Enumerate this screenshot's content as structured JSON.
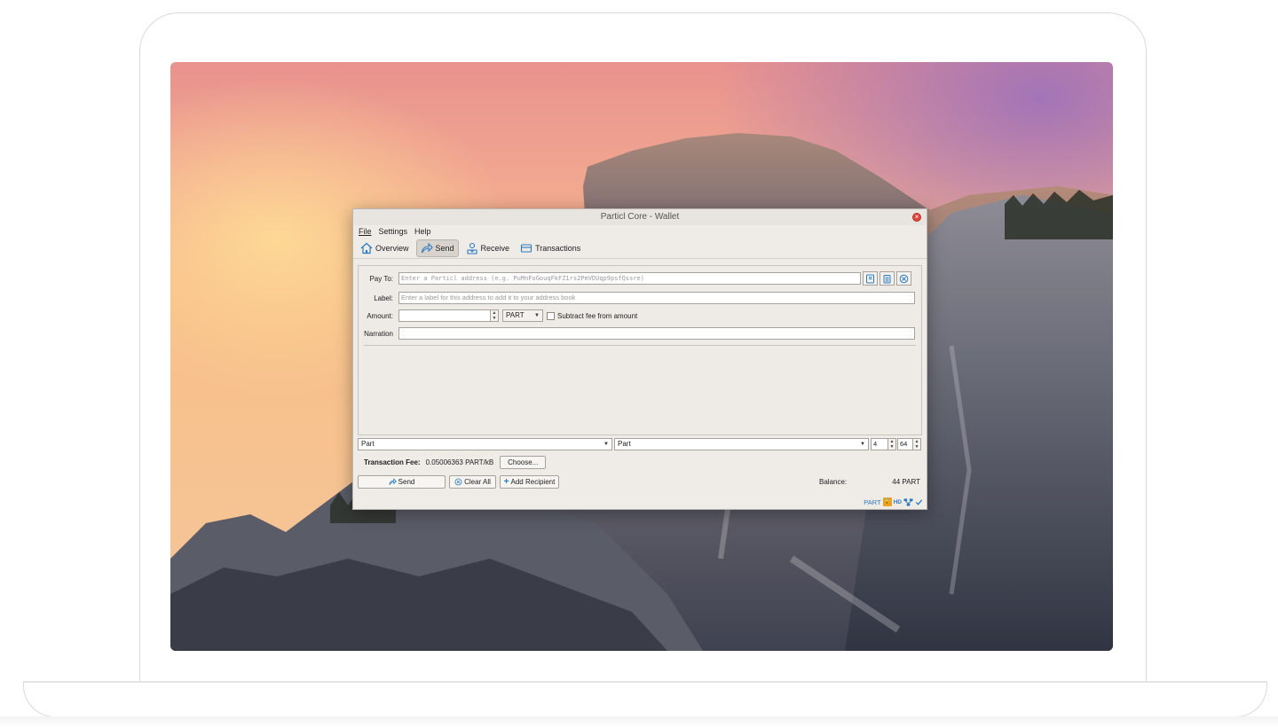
{
  "window": {
    "title": "Particl Core - Wallet",
    "close_glyph": "×"
  },
  "menu": {
    "file": "File",
    "settings": "Settings",
    "help": "Help"
  },
  "toolbar": {
    "overview": "Overview",
    "send": "Send",
    "receive": "Receive",
    "transactions": "Transactions",
    "active_tab": "Send"
  },
  "form": {
    "pay_to_label": "Pay To:",
    "pay_to_placeholder": "Enter a Particl address (e.g. PuMnFoGouqFkFZ1rs2PmVDUqp9psfQssre)",
    "label_label": "Label:",
    "label_placeholder": "Enter a label for this address to add it to your address book",
    "amount_label": "Amount:",
    "amount_value": "",
    "unit_selected": "PART",
    "subtract_fee_label": "Subtract fee from amount",
    "subtract_fee_checked": false,
    "narration_label": "Narration",
    "narration_value": ""
  },
  "type_selectors": {
    "from_type": "Part",
    "to_type": "Part",
    "ring_size": "4",
    "inputs_per_sig": "64"
  },
  "fee": {
    "label": "Transaction Fee:",
    "value": "0.05006363 PART/kB",
    "choose_button": "Choose..."
  },
  "actions": {
    "send_button": "Send",
    "clear_all_button": "Clear All",
    "add_recipient_button": "Add Recipient",
    "balance_label": "Balance:",
    "balance_value": "44 PART"
  },
  "status": {
    "unit": "PART",
    "hd": "HD"
  },
  "colors": {
    "accent": "#2b7ac0",
    "window_bg": "#efebe7",
    "close_red": "#e0453c",
    "lock_orange": "#f0a020"
  }
}
